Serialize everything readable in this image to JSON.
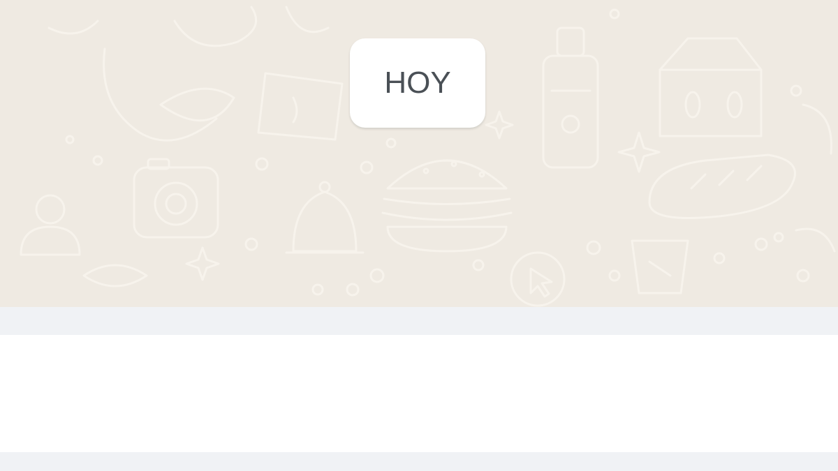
{
  "chat": {
    "date_separator": "HOY"
  },
  "theme": {
    "chat_background": "#efeae2",
    "doodle_color": "#f7f3ec",
    "chip_background": "#ffffff",
    "chip_text": "#4a5056",
    "panel_background": "#f0f2f5",
    "compose_background": "#ffffff"
  },
  "background_doodles": [
    "camera-icon",
    "burger-icon",
    "bell-icon",
    "bottle-icon",
    "milk-carton-icon",
    "bread-icon",
    "sparkle-icon",
    "cursor-icon",
    "leaf-icon",
    "person-icon"
  ]
}
